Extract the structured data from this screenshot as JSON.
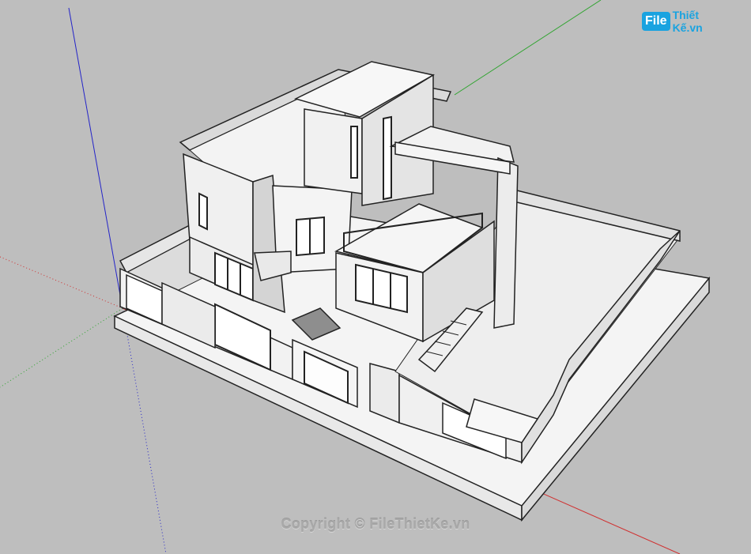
{
  "watermark": {
    "logo_file": "File",
    "logo_rest": "Thiết Kế.vn",
    "copyright": "Copyright © FileThietKe.vn"
  },
  "colors": {
    "background": "#bebebe",
    "axis_red": "#d03030",
    "axis_green": "#2fa42f",
    "axis_blue": "#2424c8",
    "brand_blue": "#1aa3e0"
  }
}
